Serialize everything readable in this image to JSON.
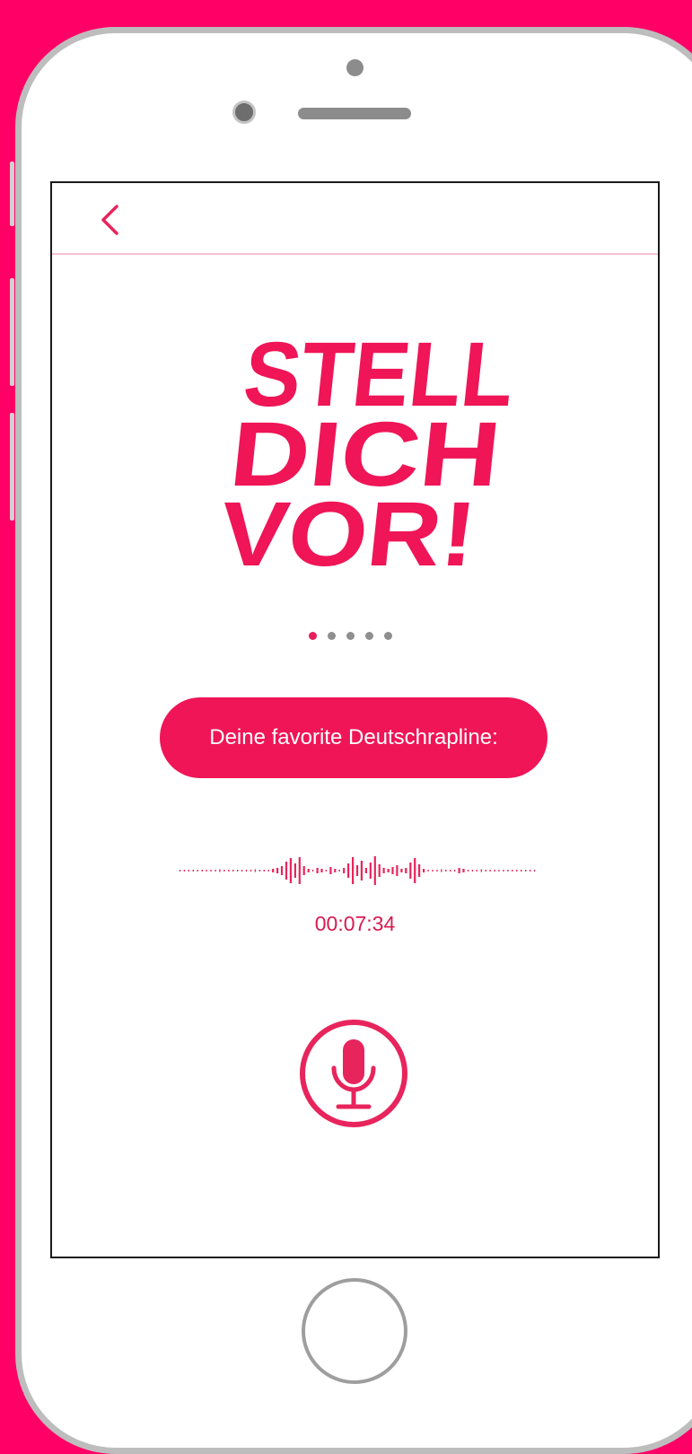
{
  "app": {
    "logo_lines": [
      "STELL",
      "DICH",
      "VOR!"
    ]
  },
  "pagination": {
    "count": 5,
    "active_index": 0
  },
  "prompt": {
    "label": "Deine favorite Deutschrapline:"
  },
  "recording": {
    "elapsed": "00:07:34"
  },
  "icons": {
    "back": "chevron-left-icon",
    "microphone": "microphone-icon"
  },
  "colors": {
    "background": "#ff0066",
    "accent": "#ef1556",
    "text_accent": "#d81b52",
    "device_frame": "#bdbdbd",
    "screen_divider": "#f7c1d6"
  }
}
